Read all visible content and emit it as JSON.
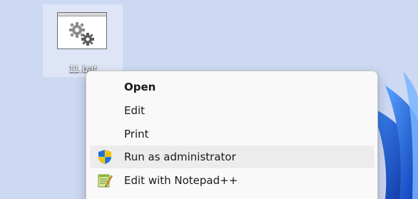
{
  "desktop_icon": {
    "label": "11.bat",
    "icon": "gears-icon"
  },
  "context_menu": {
    "items": [
      {
        "label": "Open",
        "bold": true,
        "icon": ""
      },
      {
        "label": "Edit",
        "bold": false,
        "icon": ""
      },
      {
        "label": "Print",
        "bold": false,
        "icon": ""
      },
      {
        "label": "Run as administrator",
        "bold": false,
        "icon": "uac-shield-icon",
        "hovered": true
      },
      {
        "label": "Edit with Notepad++",
        "bold": false,
        "icon": "notepad-plus-plus-icon"
      }
    ]
  },
  "colors": {
    "menu_background": "#f9f9f9",
    "hover_background": "#ececec",
    "wallpaper_blue": "#1a5fd4"
  }
}
